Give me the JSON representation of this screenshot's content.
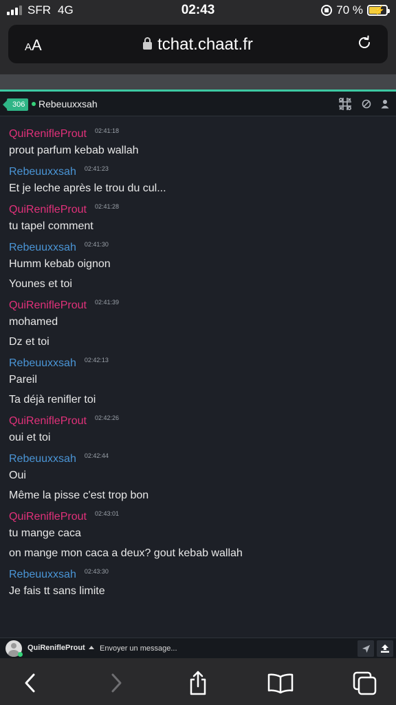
{
  "status_bar": {
    "carrier": "SFR",
    "network": "4G",
    "time": "02:43",
    "battery_text": "70 %",
    "battery_level": 0.7,
    "icons": [
      "signal-icon",
      "rotation-lock-icon",
      "battery-charging-icon"
    ]
  },
  "browser": {
    "text_size_label": "AA",
    "url": "tchat.chaat.fr",
    "icons": [
      "padlock-icon",
      "reload-icon"
    ]
  },
  "chat": {
    "user_count": "306",
    "partner_name": "Rebeuuxxsah",
    "header_icons": [
      "tictactoe-icon",
      "block-icon",
      "profile-icon"
    ],
    "accent_color": "#3dc9a3",
    "colors": {
      "me": "#e1317a",
      "partner": "#4a95d6"
    },
    "messages": [
      {
        "author": "QuiRenifleProut",
        "side": "me",
        "time": "02:41:18",
        "lines": [
          "prout parfum kebab wallah"
        ]
      },
      {
        "author": "Rebeuuxxsah",
        "side": "partner",
        "time": "02:41:23",
        "lines": [
          "Et je leche après le trou du cul..."
        ]
      },
      {
        "author": "QuiRenifleProut",
        "side": "me",
        "time": "02:41:28",
        "lines": [
          "tu tapel comment"
        ]
      },
      {
        "author": "Rebeuuxxsah",
        "side": "partner",
        "time": "02:41:30",
        "lines": [
          "Humm kebab oignon",
          "Younes et toi"
        ]
      },
      {
        "author": "QuiRenifleProut",
        "side": "me",
        "time": "02:41:39",
        "lines": [
          "mohamed",
          "Dz et toi"
        ]
      },
      {
        "author": "Rebeuuxxsah",
        "side": "partner",
        "time": "02:42:13",
        "lines": [
          "Pareil",
          "Ta déjà renifler toi"
        ]
      },
      {
        "author": "QuiRenifleProut",
        "side": "me",
        "time": "02:42:26",
        "lines": [
          "oui et toi"
        ]
      },
      {
        "author": "Rebeuuxxsah",
        "side": "partner",
        "time": "02:42:44",
        "lines": [
          "Oui",
          "Même la pisse c'est trop bon"
        ]
      },
      {
        "author": "QuiRenifleProut",
        "side": "me",
        "time": "02:43:01",
        "lines": [
          "tu mange caca",
          "on mange mon caca a deux? gout kebab wallah"
        ]
      },
      {
        "author": "Rebeuuxxsah",
        "side": "partner",
        "time": "02:43:30",
        "lines": [
          "Je fais tt sans limite"
        ]
      }
    ]
  },
  "composer": {
    "username": "QuiRenifleProut",
    "placeholder": "Envoyer un message...",
    "icons": [
      "send-icon",
      "upload-icon"
    ]
  },
  "toolbar": {
    "icons": [
      "back-icon",
      "forward-icon",
      "share-icon",
      "bookmarks-icon",
      "tabs-icon"
    ]
  }
}
